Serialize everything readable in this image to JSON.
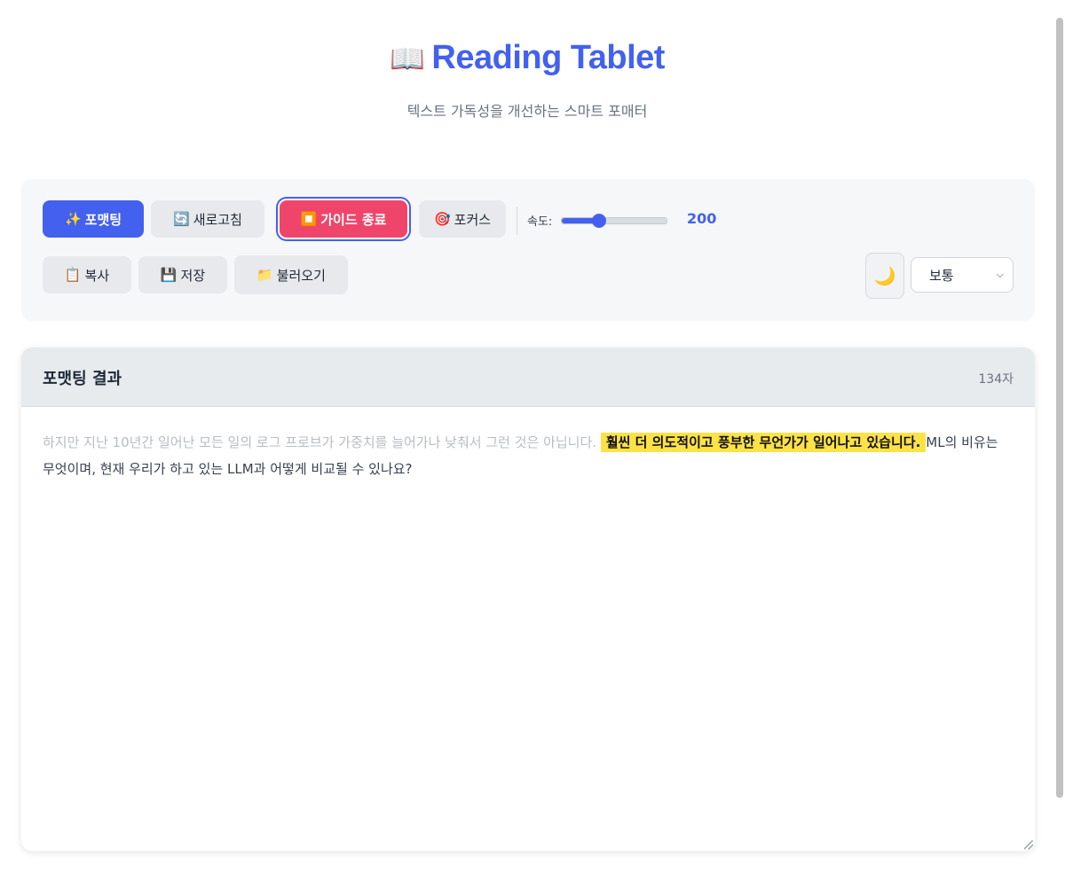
{
  "app": {
    "title": "Reading Tablet",
    "title_icon": "📖",
    "subtitle": "텍스트 가독성을 개선하는 스마트 포매터"
  },
  "toolbar": {
    "format_icon": "✨",
    "format_label": "포맷팅",
    "refresh_icon": "🔄",
    "refresh_label": "새로고침",
    "guide_icon": "⏹️",
    "guide_label": "가이드 종료",
    "focus_icon": "🎯",
    "focus_label": "포커스",
    "speed_label": "속도:",
    "speed_value": "200",
    "speed_fraction": 0.36,
    "copy_icon": "📋",
    "copy_label": "복사",
    "save_icon": "💾",
    "save_label": "저장",
    "load_icon": "📁",
    "load_label": "불러오기",
    "theme_icon": "🌙",
    "size_select": {
      "selected": "보통"
    }
  },
  "result": {
    "title": "포맷팅 결과",
    "char_count": "134자",
    "text_faded": "하지만 지난 10년간 일어난 모든 일의 로그 프로브가 가중치를 늘어가나 낮춰서 그런 것은 아닙니다.",
    "text_highlight": "훨씬 더 의도적이고 풍부한 무언가가 일어나고 있습니다.",
    "text_rest": "ML의 비유는 무엇이며, 현재 우리가 하고 있는 LLM과 어떻게 비교될 수 있나요?"
  },
  "colors": {
    "accent": "#4361ee",
    "danger": "#f0456b",
    "highlight": "#fde247"
  }
}
